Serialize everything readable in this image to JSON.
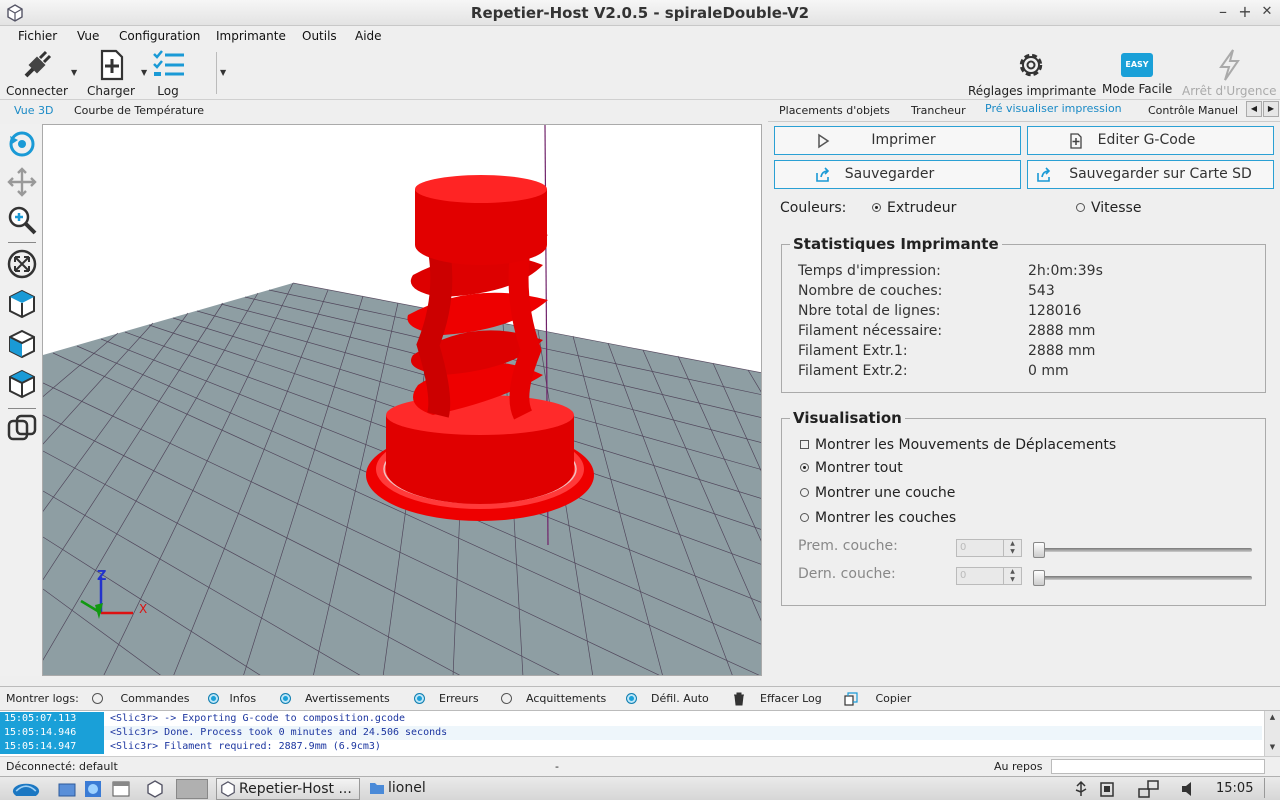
{
  "window": {
    "title": "Repetier-Host V2.0.5 - spiraleDouble-V2",
    "minimize": "–",
    "maximize": "+",
    "close": "✕"
  },
  "menu": [
    "Fichier",
    "Vue",
    "Configuration",
    "Imprimante",
    "Outils",
    "Aide"
  ],
  "toolbar": {
    "connect": "Connecter",
    "load": "Charger",
    "log": "Log",
    "printer_settings": "Réglages imprimante",
    "easy_mode": "Mode Facile",
    "easy_badge": "EASY",
    "emergency": "Arrêt d'Urgence"
  },
  "left_tabs": [
    "Vue 3D",
    "Courbe de Température"
  ],
  "right_tabs": [
    "Placements d'objets",
    "Trancheur",
    "Pré visualiser impression",
    "Contrôle Manuel"
  ],
  "preview": {
    "print_btn": "Imprimer",
    "edit_gcode_btn": "Editer G-Code",
    "save_btn": "Sauvegarder",
    "save_sd_btn": "Sauvegarder sur Carte SD",
    "colors_label": "Couleurs:",
    "color_extruder": "Extrudeur",
    "color_speed": "Vitesse"
  },
  "stats": {
    "title": "Statistiques Imprimante",
    "rows": [
      {
        "label": "Temps d'impression:",
        "value": "2h:0m:39s"
      },
      {
        "label": "Nombre de couches:",
        "value": "543"
      },
      {
        "label": "Nbre total de lignes:",
        "value": "128016"
      },
      {
        "label": "Filament nécessaire:",
        "value": "2888 mm"
      },
      {
        "label": "Filament Extr.1:",
        "value": "2888 mm"
      },
      {
        "label": "Filament Extr.2:",
        "value": "0 mm"
      }
    ]
  },
  "visualisation": {
    "title": "Visualisation",
    "show_travel": "Montrer les Mouvements de Déplacements",
    "show_all": "Montrer tout",
    "show_one_layer": "Montrer une couche",
    "show_layers": "Montrer les couches",
    "first_layer_label": "Prem. couche:",
    "last_layer_label": "Dern. couche:",
    "first_layer_value": "0",
    "last_layer_value": "0"
  },
  "logbar": {
    "show_logs": "Montrer logs:",
    "commands": "Commandes",
    "infos": "Infos",
    "warnings": "Avertissements",
    "errors": "Erreurs",
    "acks": "Acquittements",
    "autoscroll": "Défil. Auto",
    "clear": "Effacer Log",
    "copy": "Copier"
  },
  "log": [
    {
      "time": "15:05:07.113",
      "msg": "<Slic3r> -> Exporting G-code to composition.gcode"
    },
    {
      "time": "15:05:14.946",
      "msg": "<Slic3r> Done. Process took 0 minutes and 24.506 seconds"
    },
    {
      "time": "15:05:14.947",
      "msg": "<Slic3r> Filament required: 2887.9mm (6.9cm3)"
    }
  ],
  "status": {
    "left": "Déconnecté: default",
    "middle": "-",
    "right": "Au repos"
  },
  "taskbar": {
    "app": "Repetier-Host ...",
    "folder": "lionel",
    "clock": "15:05"
  },
  "axes": {
    "x": "X",
    "z": "Z"
  },
  "colors": {
    "accent": "#1a8ac6",
    "model": "#ee0000",
    "bed": "#8e9ea3"
  }
}
